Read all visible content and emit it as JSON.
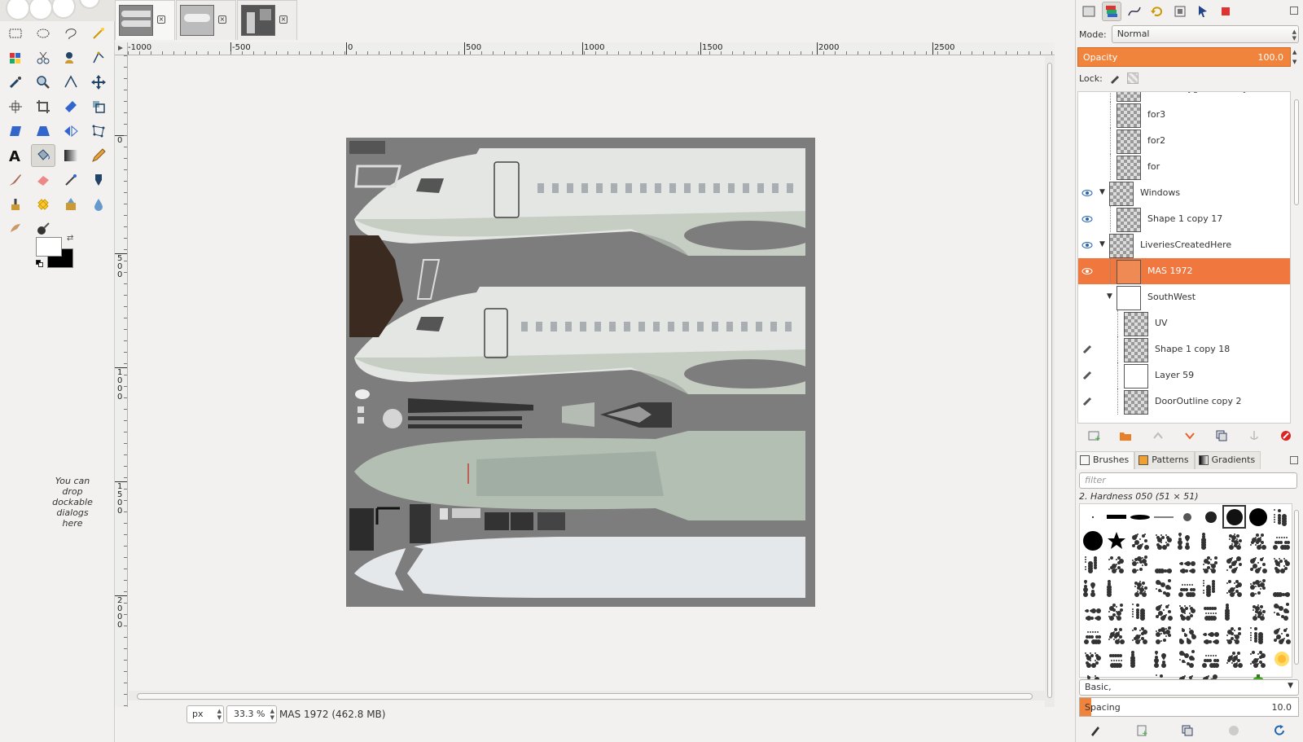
{
  "toolbox": {
    "drop_hint": "You can drop dockable dialogs here"
  },
  "image_window": {
    "tabs": [
      {
        "name": "image-tab-1",
        "active": true
      },
      {
        "name": "image-tab-2",
        "active": false
      },
      {
        "name": "image-tab-3",
        "active": false
      }
    ],
    "hruler_labels": [
      "-1000",
      "-500",
      "0",
      "500",
      "1000",
      "1500",
      "2000",
      "2500"
    ],
    "vruler_labels": [
      "0",
      "500",
      "1000",
      "1500",
      "2000"
    ],
    "unit": "px",
    "zoom": "33.3 %",
    "status": "MAS 1972 (462.8 MB)"
  },
  "dock": {
    "mode_label": "Mode:",
    "mode_value": "Normal",
    "opacity_label": "Opacity",
    "opacity_value": "100.0",
    "lock_label": "Lock:",
    "layers": [
      {
        "name": "Show Polygons + Only",
        "visible": false,
        "indent": 1,
        "expander": false,
        "thumb": "checker",
        "selected": false,
        "partial": true
      },
      {
        "name": "for3",
        "visible": false,
        "indent": 1,
        "expander": false,
        "thumb": "checker",
        "selected": false
      },
      {
        "name": "for2",
        "visible": false,
        "indent": 1,
        "expander": false,
        "thumb": "checker",
        "selected": false
      },
      {
        "name": "for",
        "visible": false,
        "indent": 1,
        "expander": false,
        "thumb": "checker",
        "selected": false
      },
      {
        "name": "Windows",
        "visible": true,
        "indent": 0,
        "expander": true,
        "thumb": "checker",
        "selected": false
      },
      {
        "name": "Shape 1 copy 17",
        "visible": true,
        "indent": 1,
        "expander": false,
        "thumb": "checker",
        "selected": false
      },
      {
        "name": "LiveriesCreatedHere",
        "visible": true,
        "indent": 0,
        "expander": true,
        "thumb": "checker",
        "selected": false
      },
      {
        "name": "MAS 1972",
        "visible": true,
        "indent": 1,
        "expander": false,
        "thumb": "folder",
        "selected": true
      },
      {
        "name": "SouthWest",
        "visible": false,
        "indent": 1,
        "expander": true,
        "thumb": "white",
        "selected": false
      },
      {
        "name": "UV",
        "visible": false,
        "indent": 2,
        "expander": false,
        "thumb": "checker",
        "selected": false
      },
      {
        "name": "Shape 1 copy 18",
        "visible": true,
        "indent": 2,
        "expander": false,
        "thumb": "checker",
        "selected": false,
        "linked": true
      },
      {
        "name": "Layer 59",
        "visible": true,
        "indent": 2,
        "expander": false,
        "thumb": "white",
        "selected": false,
        "linked": true
      },
      {
        "name": "DoorOutline copy 2",
        "visible": true,
        "indent": 2,
        "expander": false,
        "thumb": "checker",
        "selected": false,
        "linked": true
      }
    ],
    "brush_tabs": [
      "Brushes",
      "Patterns",
      "Gradients"
    ],
    "filter_placeholder": "filter",
    "brush_name": "2. Hardness 050 (51 × 51)",
    "preset": "Basic,",
    "spacing_label": "Spacing",
    "spacing_value": "10.0",
    "colors": {
      "accent": "#f0843c",
      "selected_row": "#f0773e"
    }
  }
}
